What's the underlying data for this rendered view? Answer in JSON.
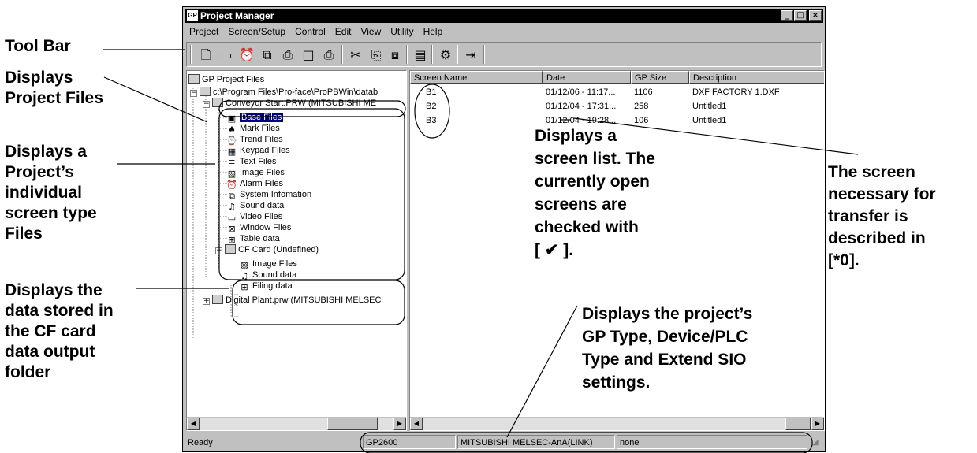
{
  "window": {
    "title": "Project Manager",
    "app_icon": "GP",
    "buttons": [
      "_",
      "□",
      "×"
    ]
  },
  "menu": [
    "Project",
    "Screen/Setup",
    "Control",
    "Edit",
    "View",
    "Utility",
    "Help"
  ],
  "toolbar_icons": [
    "new-file-icon",
    "window-icon",
    "alarm-clock-icon",
    "project-info-icon",
    "transfer-icon",
    "screen-icon",
    "print-icon",
    "cut-icon",
    "copy-icon",
    "paste-icon",
    "list-view-icon",
    "settings-icon",
    "exit-icon"
  ],
  "tree": {
    "root": "GP Project Files",
    "path": "c:\\Program Files\\Pro-face\\ProPBWin\\datab",
    "project1": "Conveyor Start.PRW (MITSUBISHI ME",
    "items": [
      "Base Files",
      "Mark Files",
      "Trend Files",
      "Keypad Files",
      "Text Files",
      "Image Files",
      "Alarm Files",
      "System Infomation",
      "Sound data",
      "Video Files",
      "Window Files",
      "Table data"
    ],
    "cf_card": "CF Card (Undefined)",
    "cf_items": [
      "Image Files",
      "Sound data",
      "Filing data"
    ],
    "project2": "Digital Plant.prw (MITSUBISHI MELSEC"
  },
  "list": {
    "columns": [
      "Screen Name",
      "Date",
      "GP Size",
      "Description"
    ],
    "rows": [
      {
        "name": "B1",
        "date": "01/12/06 - 11:17...",
        "size": "1106",
        "desc": "DXF FACTORY 1.DXF"
      },
      {
        "name": "B2",
        "date": "01/12/04 - 17:31...",
        "size": "258",
        "desc": "Untitled1"
      },
      {
        "name": "B3",
        "date": "01/12/04 - 19:28...",
        "size": "106",
        "desc": "Untitled1"
      }
    ]
  },
  "status": {
    "text": "Ready",
    "gp_type": "GP2600",
    "plc_type": "MITSUBISHI MELSEC-AnA(LINK)",
    "sio": "none"
  },
  "callouts": {
    "toolbar": "Tool Bar",
    "project_files": "Displays\nProject Files",
    "screen_types": "Displays a\nProject’s\nindividual\nscreen type\nFiles",
    "cf_card": "Displays the\ndata stored in\nthe CF card\ndata output\nfolder",
    "screen_list": "Displays a\nscreen list. The\ncurrently open\nscreens are\nchecked with\n[ ✔ ].",
    "transfer": "The screen\nnecessary for\ntransfer is\ndescribed in\n[*0].",
    "settings": "Displays the project’s\nGP Type, Device/PLC\nType and Extend SIO\nsettings."
  }
}
